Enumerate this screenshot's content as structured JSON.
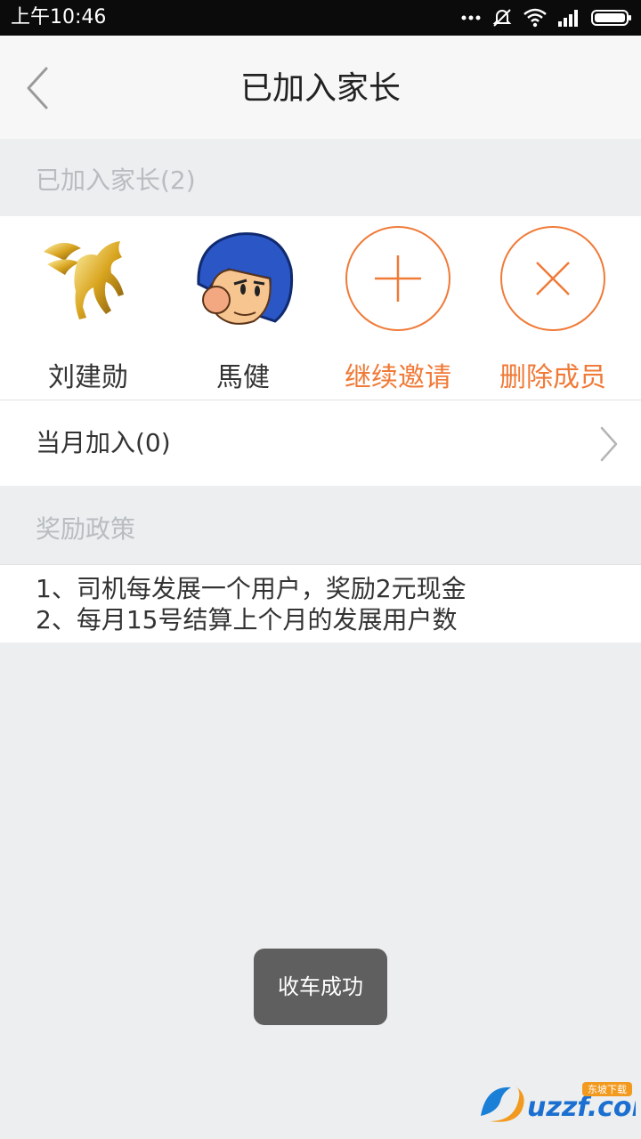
{
  "status_bar": {
    "time": "上午10:46",
    "icons": [
      "more-dots-icon",
      "mute-icon",
      "wifi-icon",
      "signal-icon",
      "battery-icon"
    ]
  },
  "header": {
    "title": "已加入家长",
    "back_icon": "chevron-left-icon"
  },
  "joined": {
    "section_title": "已加入家长(2)",
    "members": [
      {
        "name": "刘建勋",
        "avatar": "pegasus-avatar"
      },
      {
        "name": "馬健",
        "avatar": "cartoon-face-avatar"
      }
    ],
    "actions": [
      {
        "label": "继续邀请",
        "icon": "plus-circle-icon"
      },
      {
        "label": "删除成员",
        "icon": "close-circle-icon"
      }
    ]
  },
  "month": {
    "label": "当月加入(0)",
    "chevron_icon": "chevron-right-icon"
  },
  "policy": {
    "section_title": "奖励政策",
    "lines": [
      "1、司机每发展一个用户，奖励2元现金",
      "2、每月15号结算上个月的发展用户数"
    ]
  },
  "toast": {
    "text": "收车成功"
  },
  "watermark": {
    "text": "uzzf.com",
    "subtext": "东坡下载"
  },
  "colors": {
    "accent": "#f07a37",
    "background": "#eceef0",
    "section_label": "#b9bcc0",
    "toast_bg": "#5f5f5f"
  }
}
